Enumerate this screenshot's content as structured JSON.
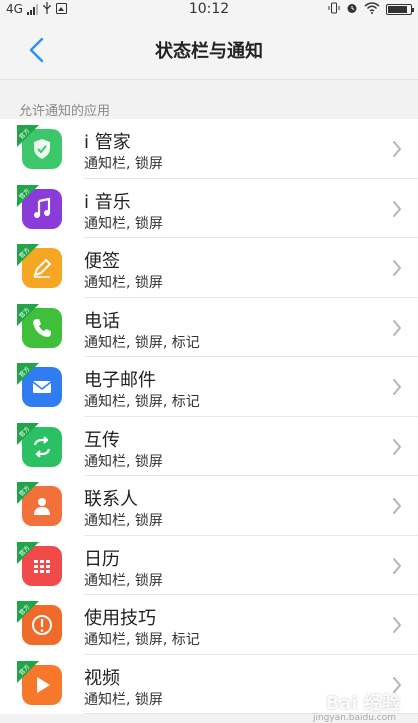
{
  "status_bar": {
    "network": "4G",
    "time": "10:12",
    "battery_level": 0.85
  },
  "header": {
    "title": "状态栏与通知"
  },
  "section": {
    "label": "允许通知的应用"
  },
  "badge_text": "官方",
  "apps": [
    {
      "name": "i 管家",
      "sub": "通知栏, 锁屏",
      "color": "#3cc76a",
      "icon": "shield-icon"
    },
    {
      "name": "i 音乐",
      "sub": "通知栏, 锁屏",
      "color": "#8a3bd9",
      "icon": "music-note-icon"
    },
    {
      "name": "便签",
      "sub": "通知栏, 锁屏",
      "color": "#f5a623",
      "icon": "pencil-icon"
    },
    {
      "name": "电话",
      "sub": "通知栏, 锁屏, 标记",
      "color": "#3fbf3a",
      "icon": "phone-icon"
    },
    {
      "name": "电子邮件",
      "sub": "通知栏, 锁屏, 标记",
      "color": "#2f7df0",
      "icon": "envelope-icon"
    },
    {
      "name": "互传",
      "sub": "通知栏, 锁屏",
      "color": "#2cc064",
      "icon": "transfer-arrows-icon"
    },
    {
      "name": "联系人",
      "sub": "通知栏, 锁屏",
      "color": "#f2703a",
      "icon": "person-icon"
    },
    {
      "name": "日历",
      "sub": "通知栏, 锁屏",
      "color": "#f04a4a",
      "icon": "calendar-grid-icon"
    },
    {
      "name": "使用技巧",
      "sub": "通知栏, 锁屏, 标记",
      "color": "#f06a2a",
      "icon": "exclamation-circle-icon"
    },
    {
      "name": "视频",
      "sub": "通知栏, 锁屏",
      "color": "#f7782a",
      "icon": "play-icon"
    }
  ],
  "colors": {
    "accent": "#2b8ff5",
    "badge": "#21a548"
  },
  "watermark": {
    "brand": "Bai 经验",
    "url": "jingyan.baidu.com"
  }
}
